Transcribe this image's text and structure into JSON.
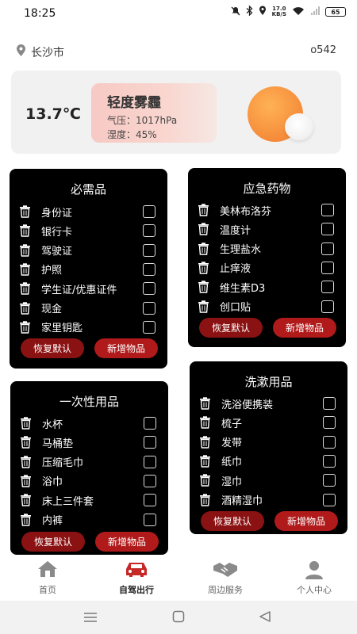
{
  "status": {
    "time": "18:25",
    "net_speed_value": "17.0",
    "net_speed_unit": "KB/S",
    "battery": "65"
  },
  "location": {
    "city": "长沙市",
    "code": "o542"
  },
  "weather": {
    "temperature": "13.7℃",
    "condition": "轻度雾霾",
    "pressure": "气压：1017hPa",
    "humidity": "湿度：45%"
  },
  "cards": {
    "essentials": {
      "title": "必需品",
      "items": [
        "身份证",
        "银行卡",
        "驾驶证",
        "护照",
        "学生证/优惠证件",
        "现金",
        "家里钥匙"
      ],
      "reset": "恢复默认",
      "add": "新增物品"
    },
    "medicine": {
      "title": "应急药物",
      "items": [
        "美林布洛芬",
        "温度计",
        "生理盐水",
        "止痒液",
        "维生素D3",
        "创口贴"
      ],
      "reset": "恢复默认",
      "add": "新增物品"
    },
    "toiletries": {
      "title": "洗漱用品",
      "items": [
        "洗浴便携装",
        "梳子",
        "发带",
        "纸巾",
        "湿巾",
        "酒精湿巾"
      ],
      "reset": "恢复默认",
      "add": "新增物品"
    },
    "disposables": {
      "title": "一次性用品",
      "items": [
        "水杯",
        "马桶垫",
        "压缩毛巾",
        "浴巾",
        "床上三件套",
        "内裤"
      ],
      "reset": "恢复默认",
      "add": "新增物品"
    }
  },
  "nav": {
    "items": [
      "首页",
      "自驾出行",
      "周边服务",
      "个人中心"
    ],
    "active": "自驾出行",
    "active_color": "#c62828"
  },
  "icons": {
    "item": "trash-icon",
    "nav": [
      "home-icon",
      "car-icon",
      "handshake-icon",
      "user-icon"
    ]
  }
}
